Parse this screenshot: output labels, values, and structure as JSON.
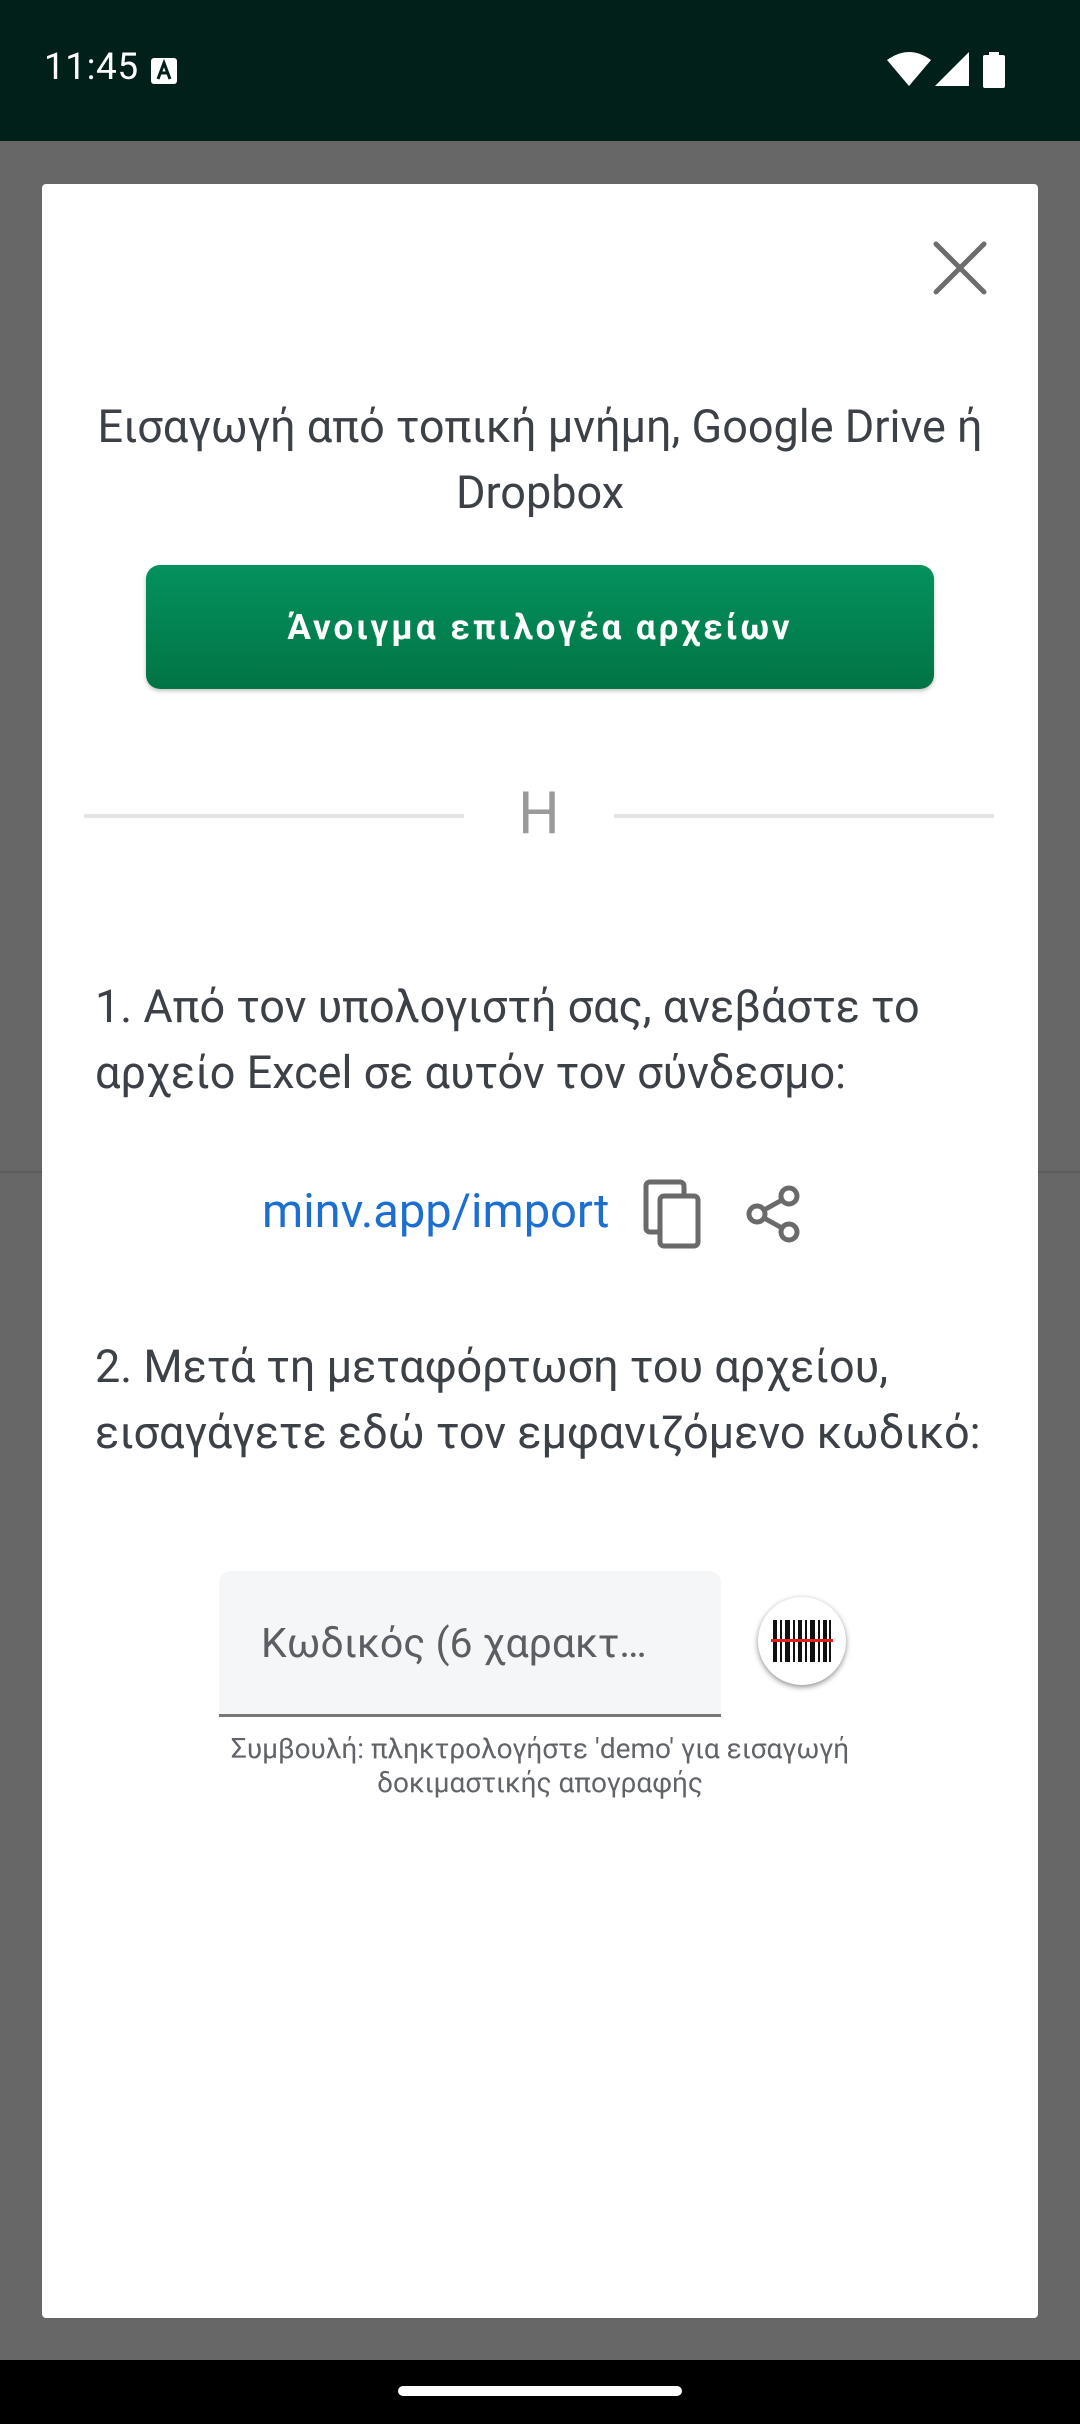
{
  "status_bar": {
    "time": "11:45",
    "icons": [
      "a-notification-icon",
      "wifi-icon",
      "signal-icon",
      "battery-icon"
    ]
  },
  "dialog": {
    "close_icon": "close-icon",
    "intro_text": "Εισαγωγή από τοπική μνήμη, Google Drive ή Dropbox",
    "open_picker_label": "Άνοιγμα επιλογέα αρχείων",
    "or_label": "Η",
    "step1_text": "1. Από τον υπολογιστή σας, ανεβάστε το αρχείο Excel σε αυτόν τον σύνδεσμο:",
    "import_link": "minv.app/import",
    "copy_icon": "copy-icon",
    "share_icon": "share-icon",
    "step2_text": "2. Μετά τη μεταφόρτωση του αρχείου, εισαγάγετε εδώ τον εμφανιζόμενο κωδικό:",
    "code_input": {
      "placeholder": "Κωδικός (6 χαρακτ…",
      "value": ""
    },
    "scan_icon": "barcode-scan-icon",
    "hint_text": "Συμβουλή: πληκτρολογήστε 'demo' για εισαγωγή δοκιμαστικής απογραφής"
  },
  "colors": {
    "status_bar_bg": "#01201a",
    "primary_button": "#027a4a",
    "link": "#1c6fd1",
    "scrim": "#676767"
  }
}
